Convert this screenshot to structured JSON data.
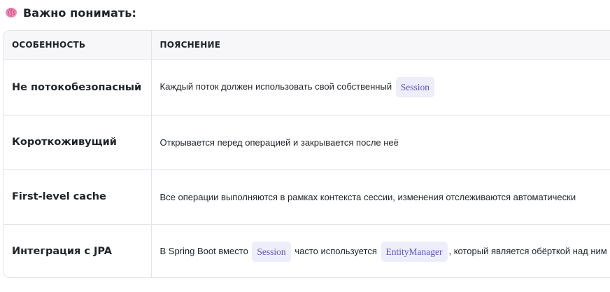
{
  "heading": {
    "icon": "brain-icon",
    "title": "Важно понимать:"
  },
  "table": {
    "columns": [
      "ОСОБЕННОСТЬ",
      "ПОЯСНЕНИЕ"
    ],
    "rows": [
      {
        "feature": "Не потокобезопасный",
        "parts": [
          "Каждый поток должен использовать свой собственный",
          "Session"
        ]
      },
      {
        "feature": "Короткоживущий",
        "parts": [
          "Открывается перед операцией и закрывается после неё"
        ]
      },
      {
        "feature": "First-level cache",
        "parts": [
          "Все операции выполняются в рамках контекста сессии, изменения отслеживаются автоматически"
        ]
      },
      {
        "feature": "Интеграция с JPA",
        "parts": [
          "В Spring Boot вместо",
          "Session",
          "часто используется",
          "EntityManager",
          ", который является обёрткой над ним"
        ]
      }
    ]
  },
  "colors": {
    "border": "#e3e3ea",
    "header_bg": "#f7f7fa",
    "code_bg": "#eeedfb",
    "code_text": "#5b57c7",
    "brain_pink": "#e86aa0"
  }
}
